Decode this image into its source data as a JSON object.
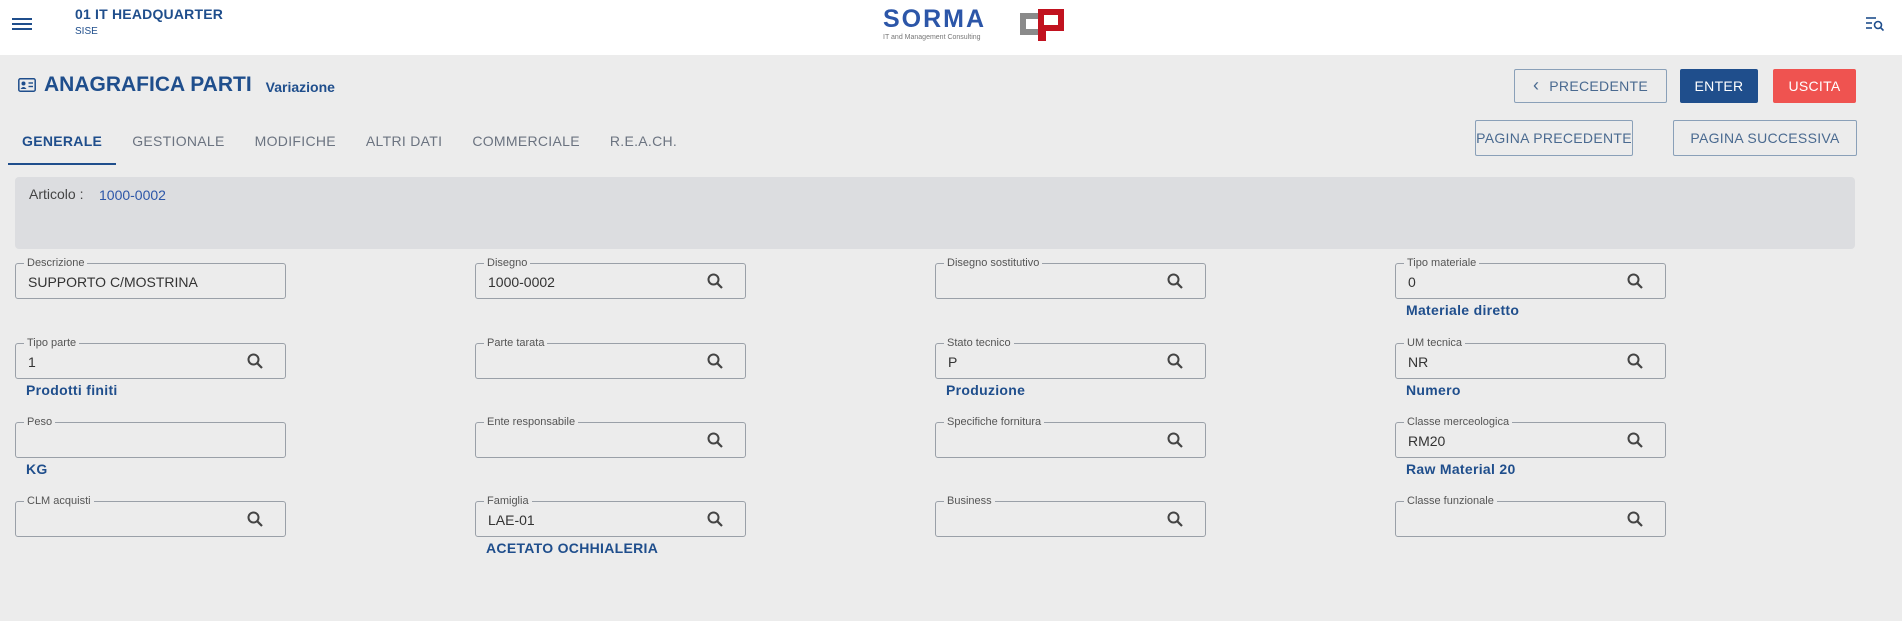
{
  "header": {
    "company_name": "01 IT HEADQUARTER",
    "company_sub": "SISE",
    "logo_text": "SORMA",
    "logo_tagline": "IT and Management Consulting",
    "menu_icon": "hamburger-menu-icon",
    "right_icon": "filter-search-icon"
  },
  "page": {
    "title": "ANAGRAFICA PARTI",
    "mode": "Variazione",
    "title_icon": "id-card-icon"
  },
  "actions": {
    "previous": "PRECEDENTE",
    "enter": "ENTER",
    "exit": "USCITA",
    "prev_page": "PAGINA PRECEDENTE",
    "next_page": "PAGINA SUCCESSIVA"
  },
  "tabs": [
    {
      "label": "GENERALE",
      "active": true
    },
    {
      "label": "GESTIONALE",
      "active": false
    },
    {
      "label": "MODIFICHE",
      "active": false
    },
    {
      "label": "ALTRI DATI",
      "active": false
    },
    {
      "label": "COMMERCIALE",
      "active": false
    },
    {
      "label": "R.E.A.CH.",
      "active": false
    }
  ],
  "article": {
    "label": "Articolo :",
    "value": "1000-0002"
  },
  "fields": {
    "descrizione": {
      "label": "Descrizione",
      "value": "SUPPORTO C/MOSTRINA"
    },
    "disegno": {
      "label": "Disegno",
      "value": "1000-0002"
    },
    "disegno_sostitutivo": {
      "label": "Disegno sostitutivo",
      "value": ""
    },
    "tipo_materiale": {
      "label": "Tipo materiale",
      "value": "0",
      "desc": "Materiale diretto"
    },
    "tipo_parte": {
      "label": "Tipo parte",
      "value": "1",
      "desc": "Prodotti finiti"
    },
    "parte_tarata": {
      "label": "Parte tarata",
      "value": ""
    },
    "stato_tecnico": {
      "label": "Stato tecnico",
      "value": "P",
      "desc": "Produzione"
    },
    "um_tecnica": {
      "label": "UM tecnica",
      "value": "NR",
      "desc": "Numero"
    },
    "peso": {
      "label": "Peso",
      "value": "",
      "desc": "KG"
    },
    "ente_responsabile": {
      "label": "Ente responsabile",
      "value": ""
    },
    "specifiche_fornitura": {
      "label": "Specifiche fornitura",
      "value": ""
    },
    "classe_merceologica": {
      "label": "Classe merceologica",
      "value": "RM20",
      "desc": "Raw Material 20"
    },
    "clm_acquisti": {
      "label": "CLM acquisti",
      "value": ""
    },
    "famiglia": {
      "label": "Famiglia",
      "value": "LAE-01",
      "desc": "ACETATO OCHHIALERIA"
    },
    "business": {
      "label": "Business",
      "value": ""
    },
    "classe_funzionale": {
      "label": "Classe funzionale",
      "value": ""
    }
  }
}
